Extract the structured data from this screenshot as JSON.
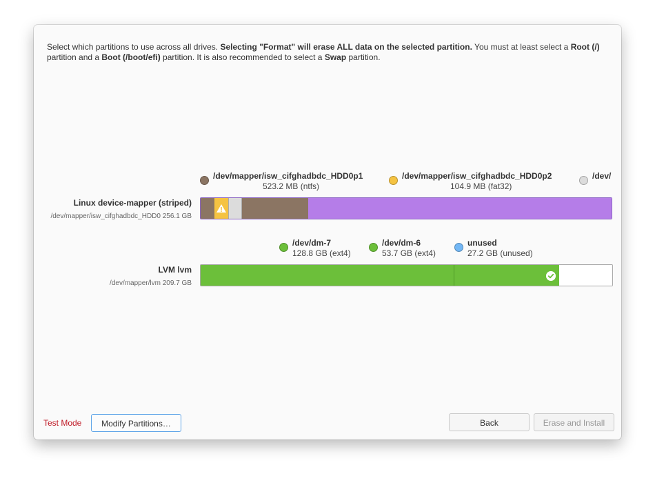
{
  "window": {
    "intro": {
      "p1": "Select which partitions to use across all drives. ",
      "b1": "Selecting \"Format\" will erase ALL data on the selected partition.",
      "p2": " You must at least select a ",
      "b2": "Root (/)",
      "p3": " partition and a ",
      "b3": "Boot (/boot/efi)",
      "p4": " partition. It is also recommended to select a ",
      "b4": "Swap",
      "p5": " partition."
    }
  },
  "disks": [
    {
      "name": "Linux device-mapper (striped)",
      "path_size": "/dev/mapper/isw_cifghadbdc_HDD0 256.1 GB",
      "legend": [
        {
          "name": "/dev/mapper/isw_cifghadbdc_HDD0p1",
          "size": "523.2 MB (ntfs)",
          "color": "#8b7563"
        },
        {
          "name": "/dev/mapper/isw_cifghadbdc_HDD0p2",
          "size": "104.9 MB (fat32)",
          "color": "#f5c342"
        },
        {
          "name": "/dev/",
          "size": "",
          "color": "#dcdcdc"
        }
      ],
      "segments": [
        {
          "color": "#8b7563"
        },
        {
          "color": "#f5c342",
          "icon": "warning-icon"
        },
        {
          "color": "#dcdcdc"
        },
        {
          "color": "#8b7563"
        },
        {
          "color": "#b57de8"
        }
      ]
    },
    {
      "name": "LVM lvm",
      "path_size": "/dev/mapper/lvm 209.7 GB",
      "legend": [
        {
          "name": "/dev/dm-7",
          "size": "128.8 GB (ext4)",
          "color": "#6cbf3a"
        },
        {
          "name": "/dev/dm-6",
          "size": "53.7 GB (ext4)",
          "color": "#6cbf3a"
        },
        {
          "name": "unused",
          "size": "27.2 GB (unused)",
          "color": "#72b7f5"
        }
      ],
      "segments": [
        {
          "color": "#6cbf3a"
        },
        {
          "color": "#6cbf3a",
          "icon": "check-icon"
        },
        {
          "color": "#ffffff"
        }
      ]
    }
  ],
  "footer": {
    "test_mode": "Test Mode",
    "modify_label": "Modify Partitions…",
    "back_label": "Back",
    "install_label": "Erase and Install"
  }
}
